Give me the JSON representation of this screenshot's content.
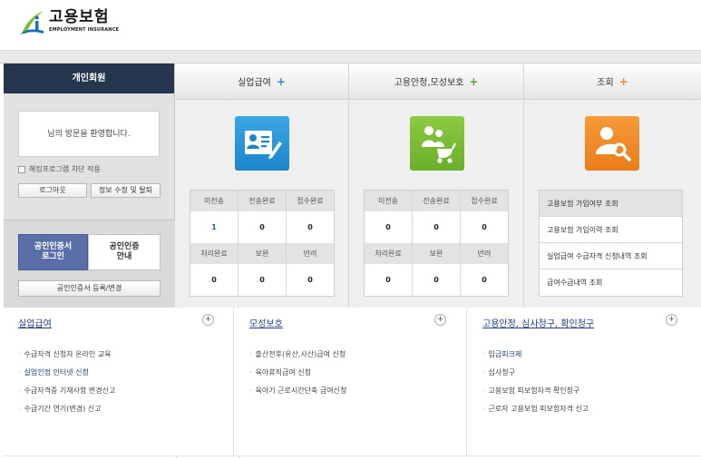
{
  "logo": {
    "korean": "고용보험",
    "english": "EMPLOYMENT INSURANCE",
    "colors": {
      "green": "#7fbf2a",
      "blue": "#1b6fb8"
    }
  },
  "member": {
    "title": "개인회원",
    "welcome": "님의 방문을 환영합니다.",
    "hack_block": "해킹프로그램 차단 적용",
    "logout": "로그아웃",
    "edit_info": "정보 수정 및 탈퇴",
    "cert_login": [
      "공인인증서",
      "로그인"
    ],
    "cert_guide": [
      "공인인증",
      "안내"
    ],
    "cert_register": "공인인증서 등록/변경"
  },
  "services": {
    "unemployment": {
      "title": "실업급여",
      "icon": "id-card-edit-icon",
      "row1_labels": [
        "미전송",
        "전송완료",
        "접수완료"
      ],
      "row1_values": [
        "1",
        "0",
        "0"
      ],
      "row2_labels": [
        "처리완료",
        "보완",
        "반려"
      ],
      "row2_values": [
        "0",
        "0",
        "0"
      ]
    },
    "stability": {
      "title": "고용안정,모성보호",
      "icon": "family-stroller-icon",
      "row1_labels": [
        "미전송",
        "전송완료",
        "접수완료"
      ],
      "row1_values": [
        "0",
        "0",
        "0"
      ],
      "row2_labels": [
        "처리완료",
        "보완",
        "반려"
      ],
      "row2_values": [
        "0",
        "0",
        "0"
      ]
    },
    "inquiry": {
      "title": "조회",
      "icon": "user-search-icon",
      "items": [
        "고용보험 가입여부 조회",
        "고용보험 가입이력 조회",
        "실업급여 수급자격 신청내역 조회",
        "급여수급내역 조회"
      ]
    }
  },
  "sections": {
    "unemployment": {
      "title": "실업급여",
      "items": [
        {
          "label": "수급자격 신청자 온라인 교육",
          "highlight": false
        },
        {
          "label": "실업인정 인터넷 신청",
          "highlight": true
        },
        {
          "label": "수급자격증 기재사항 변경신고",
          "highlight": false
        },
        {
          "label": "수급기간 연기(변경) 신고",
          "highlight": false
        }
      ]
    },
    "maternity": {
      "title": "모성보호",
      "items": [
        {
          "label": "출산전후(유산,사산)급여 신청",
          "highlight": false
        },
        {
          "label": "육아휴직급여 신청",
          "highlight": false
        },
        {
          "label": "육아기 근로시간단축 급여신청",
          "highlight": false
        }
      ]
    },
    "stability": {
      "title": "고용안정, 심사청구, 확인청구",
      "items": [
        {
          "label": "임금피크제",
          "highlight": true
        },
        {
          "label": "심사청구",
          "highlight": false
        },
        {
          "label": "고용보험 피보험자격 확인청구",
          "highlight": false
        },
        {
          "label": "근로자 고용보험 피보험자격 신고",
          "highlight": false
        }
      ]
    }
  },
  "plus_symbol": "+"
}
